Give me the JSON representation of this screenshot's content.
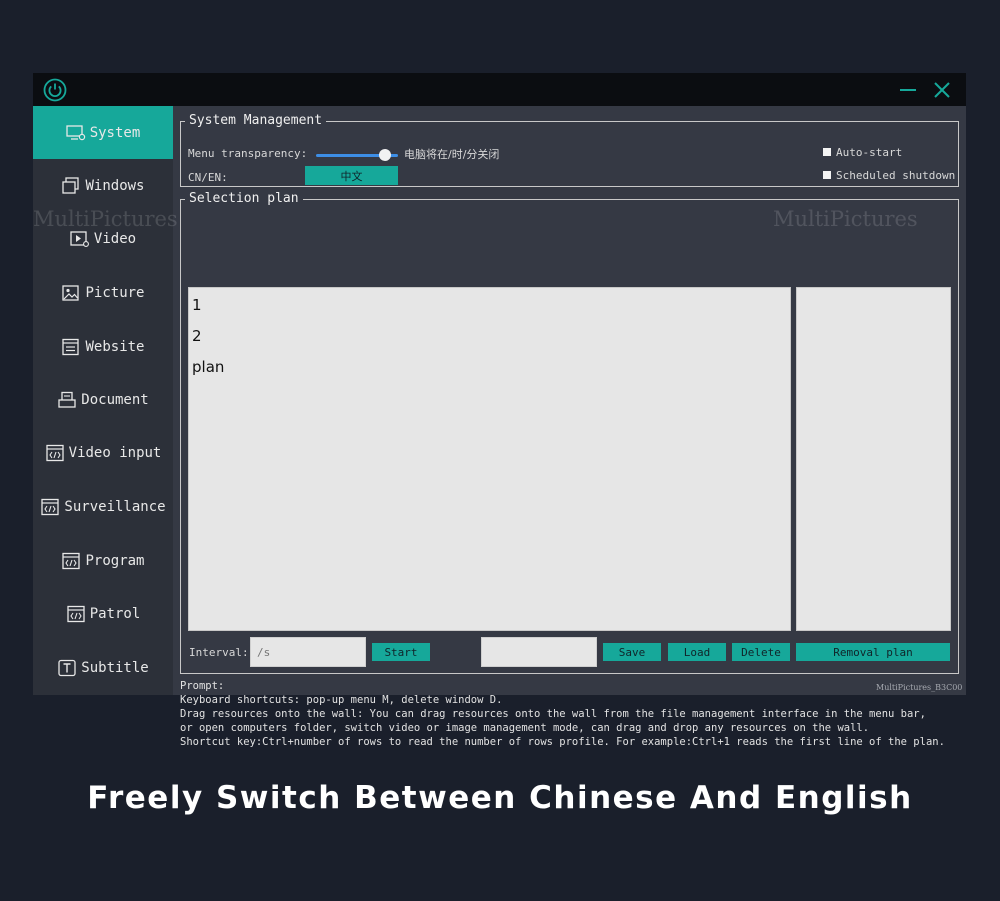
{
  "titlebar": {
    "icons": [
      "power-icon",
      "minimize-icon",
      "close-icon"
    ]
  },
  "sidebar": {
    "items": [
      {
        "label": "System",
        "icon": "monitor-gear-icon",
        "active": true
      },
      {
        "label": "Windows",
        "icon": "windows-icon"
      },
      {
        "label": "Video",
        "icon": "video-icon"
      },
      {
        "label": "Picture",
        "icon": "picture-icon"
      },
      {
        "label": "Website",
        "icon": "website-icon"
      },
      {
        "label": "Document",
        "icon": "document-icon"
      },
      {
        "label": "Video input",
        "icon": "video-input-icon"
      },
      {
        "label": "Surveillance",
        "icon": "surveillance-icon"
      },
      {
        "label": "Program",
        "icon": "program-icon"
      },
      {
        "label": "Patrol",
        "icon": "patrol-icon"
      },
      {
        "label": "Subtitle",
        "icon": "subtitle-icon"
      }
    ]
  },
  "system_management": {
    "legend": "System Management",
    "menu_transparency_label": "Menu transparency:",
    "transparency_value": 0.9,
    "shutdown_text": "电脑将在/时/分关闭",
    "cn_en_label": "CN/EN:",
    "language_button": "中文",
    "auto_start_label": "Auto-start",
    "scheduled_shutdown_label": "Scheduled shutdown"
  },
  "selection_plan": {
    "legend": "Selection plan",
    "plans": [
      "1",
      "2",
      "plan"
    ],
    "interval_label": "Interval:",
    "interval_placeholder": "/s",
    "start_button": "Start",
    "name_value": "",
    "save_button": "Save",
    "load_button": "Load",
    "delete_button": "Delete",
    "removal_button": "Removal plan"
  },
  "prompt": {
    "lines": [
      "Prompt:",
      "Keyboard shortcuts: pop-up menu M, delete window D.",
      "Drag resources onto the wall: You can drag resources onto the wall from the file management interface in the menu bar,",
      "or open computers folder, switch video or image management mode, can drag and drop any resources on the wall.",
      "Shortcut key:Ctrl+number of rows to read the number of rows profile. For example:Ctrl+1 reads the first line of the plan."
    ]
  },
  "watermarks": [
    "MultiPictures",
    "MultiPictures",
    "MultiPictures_B3C00"
  ],
  "caption": "Freely Switch Between Chinese And English",
  "colors": {
    "accent": "#16a89a",
    "titlebar": "#0b0d11",
    "panel": "#353944",
    "sidebar": "#2c3039",
    "background": "#1a1f2b"
  }
}
